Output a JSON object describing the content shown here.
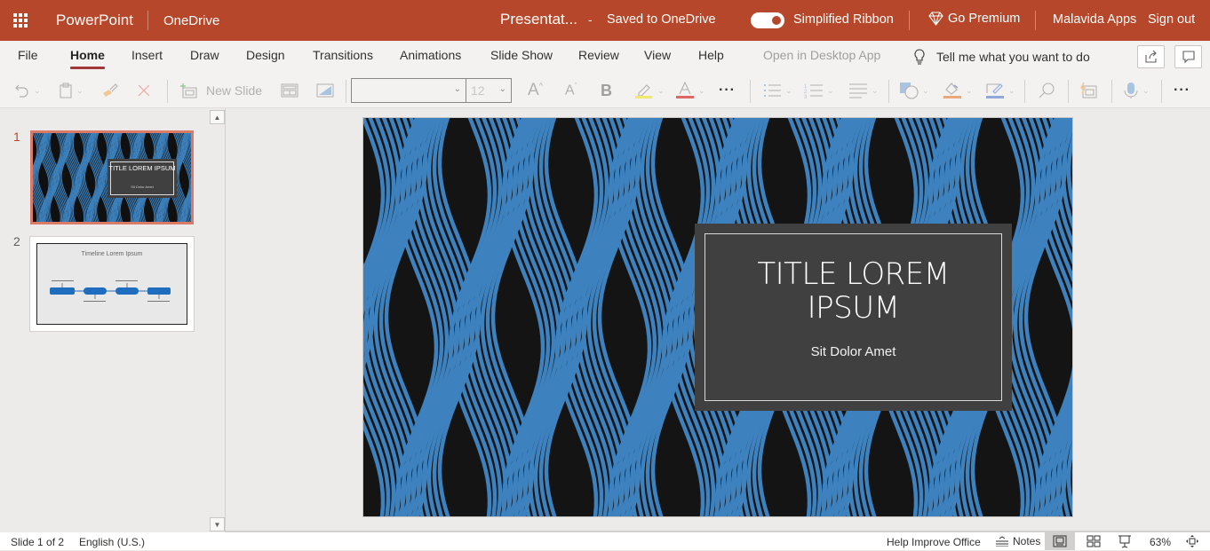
{
  "topbar": {
    "app_name": "PowerPoint",
    "location": "OneDrive",
    "doc_title": "Presentat...",
    "separator": "-",
    "save_status": "Saved to OneDrive",
    "simplified_ribbon_label": "Simplified Ribbon",
    "simplified_ribbon_on": true,
    "go_premium": "Go Premium",
    "account": "Malavida Apps",
    "sign_out": "Sign out",
    "brand_color": "#b7472a"
  },
  "tabs": [
    {
      "label": "File"
    },
    {
      "label": "Home",
      "active": true
    },
    {
      "label": "Insert"
    },
    {
      "label": "Draw"
    },
    {
      "label": "Design"
    },
    {
      "label": "Transitions"
    },
    {
      "label": "Animations"
    },
    {
      "label": "Slide Show"
    },
    {
      "label": "Review"
    },
    {
      "label": "View"
    },
    {
      "label": "Help"
    },
    {
      "label": "Open in Desktop App",
      "disabled": true
    }
  ],
  "tell_me": "Tell me what you want to do",
  "ribbon": {
    "new_slide": "New Slide",
    "font_name": "",
    "font_size": "12",
    "icons": [
      "undo-icon",
      "paste-icon",
      "format-painter-icon",
      "clear-icon",
      "new-slide-icon",
      "layout-icon",
      "background-icon",
      "grow-font-icon",
      "shrink-font-icon",
      "bold-icon",
      "highlight-icon",
      "font-color-icon",
      "more-icon",
      "bullets-icon",
      "numbering-icon",
      "align-icon",
      "shapes-icon",
      "shape-fill-icon",
      "shape-outline-icon",
      "find-icon",
      "designer-icon",
      "dictate-icon",
      "more-icon"
    ],
    "highlight_color": "#f2e86b",
    "font_color": "#e06666",
    "fill_color": "#e8a87c",
    "outline_color": "#8fa8d8"
  },
  "thumbnails": [
    {
      "number": "1",
      "title": "TITLE LOREM IPSUM",
      "subtitle": "Sit Dolor Amet",
      "selected": true
    },
    {
      "number": "2",
      "title": "Timeline Lorem Ipsum",
      "selected": false
    }
  ],
  "slide": {
    "title_line1": "TITLE LOREM",
    "title_line2": "IPSUM",
    "subtitle": "Sit Dolor Amet"
  },
  "status": {
    "slide_info": "Slide 1 of 2",
    "language": "English (U.S.)",
    "help_improve": "Help Improve Office",
    "notes": "Notes",
    "zoom": "63%"
  }
}
